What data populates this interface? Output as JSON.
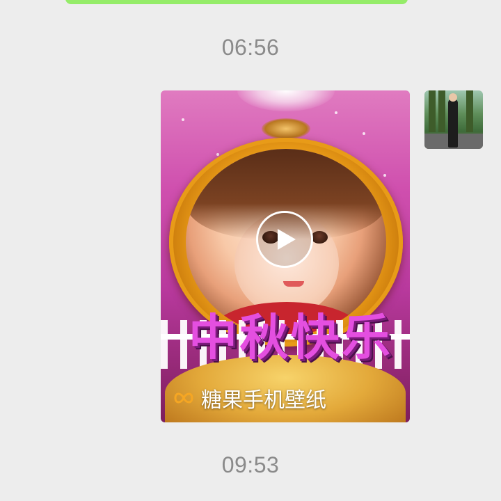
{
  "chat": {
    "timestamps": [
      "06:56",
      "09:53"
    ],
    "video_message": {
      "caption_overlay": "中秋快乐",
      "festival_chars": [
        "中",
        "秋",
        "快",
        "乐"
      ],
      "channel_name": "糖果手机壁纸",
      "icons": {
        "play": "play-icon",
        "channel_logo": "infinity-logo-icon"
      }
    }
  },
  "colors": {
    "background": "#ededed",
    "sent_bubble": "#95ec69",
    "timestamp_text": "#8a8a8a"
  }
}
